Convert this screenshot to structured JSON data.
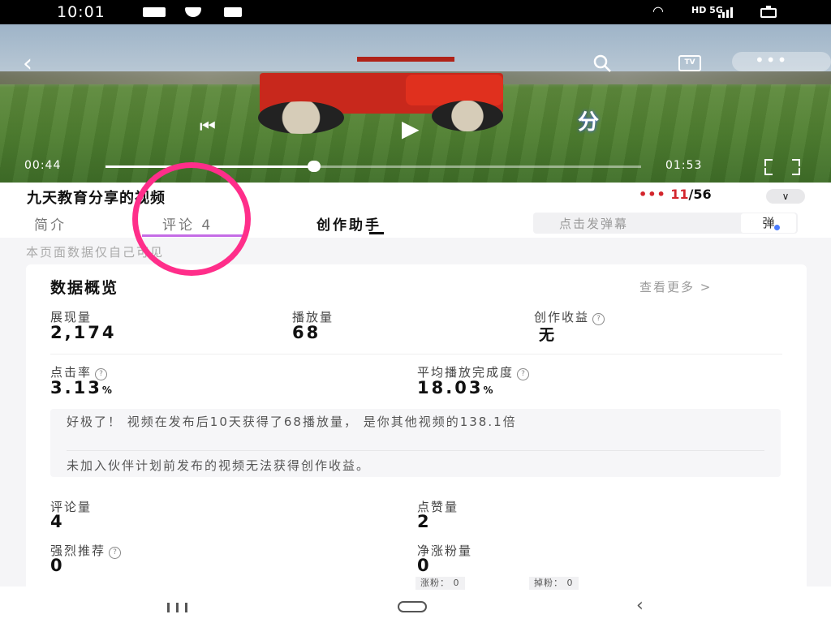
{
  "status_bar": {
    "time": "10:01",
    "network": "HD 5G"
  },
  "video": {
    "current_time": "00:44",
    "total_time": "01:53",
    "progress": 0.39,
    "share_glyph": "分"
  },
  "title_row": {
    "title": "九天教育分享的视频",
    "episode_current": "11",
    "episode_total": "/56",
    "dots": "•••"
  },
  "tabs": {
    "intro": "简介",
    "comments": "评论 4",
    "creator": "创作助手",
    "danmu_placeholder": "点击发弹幕",
    "danmu_button": "弹"
  },
  "notice": "本页面数据仅自己可见",
  "overview": {
    "title": "数据概览",
    "see_more": "查看更多 >",
    "impressions_label": "展现量",
    "impressions_value": "2,174",
    "plays_label": "播放量",
    "plays_value": "68",
    "earnings_label": "创作收益",
    "earnings_value": "无",
    "ctr_label": "点击率",
    "ctr_value": "3.13",
    "completion_label": "平均播放完成度",
    "completion_value": "18.03",
    "percent": "%",
    "insight_1": "好极了！ 视频在发布后10天获得了68播放量， 是你其他视频的138.1倍",
    "insight_2": "未加入伙伴计划前发布的视频无法获得创作收益。",
    "comments_label": "评论量",
    "comments_value": "4",
    "likes_label": "点赞量",
    "likes_value": "2",
    "recommend_label": "强烈推荐",
    "recommend_value": "0",
    "net_fans_label": "净涨粉量",
    "net_fans_value": "0",
    "fans_gained": "涨粉： 0",
    "fans_lost": "掉粉： 0"
  },
  "colors": {
    "accent_red": "#d3252c",
    "tab_purple": "#c56ce6",
    "annotation": "#ff2e8a"
  }
}
